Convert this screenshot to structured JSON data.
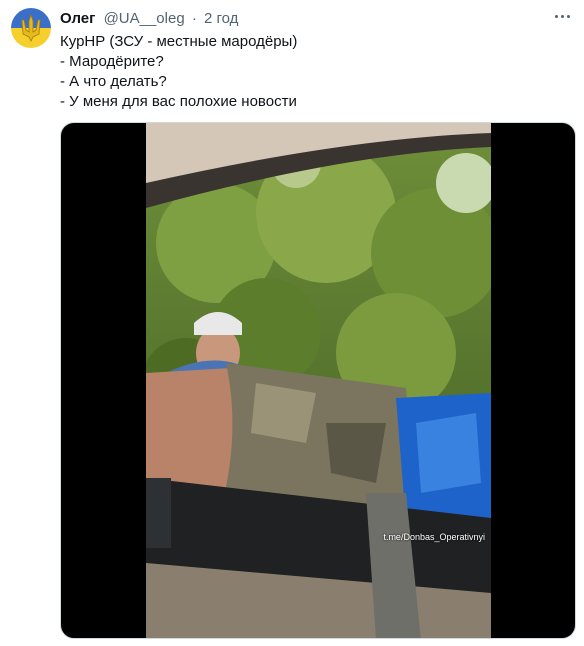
{
  "tweet": {
    "author_name": "Олег",
    "handle": "@UA__oleg",
    "separator": "·",
    "time": "2 год",
    "lines": [
      "КурНР (ЗСУ - местные мародёры)",
      "- Мародёрите?",
      "- А что делать?",
      "- У меня для вас полохие новости"
    ]
  },
  "media": {
    "watermark": "t.me/Donbas_Operativnyi"
  },
  "icons": {
    "avatar": "ukraine-trident-avatar-icon",
    "more": "more-horizontal-icon"
  },
  "colors": {
    "text_primary": "#0f1419",
    "text_secondary": "#536471",
    "flag_blue": "#3b6fc7",
    "flag_yellow": "#f5cf2c"
  }
}
